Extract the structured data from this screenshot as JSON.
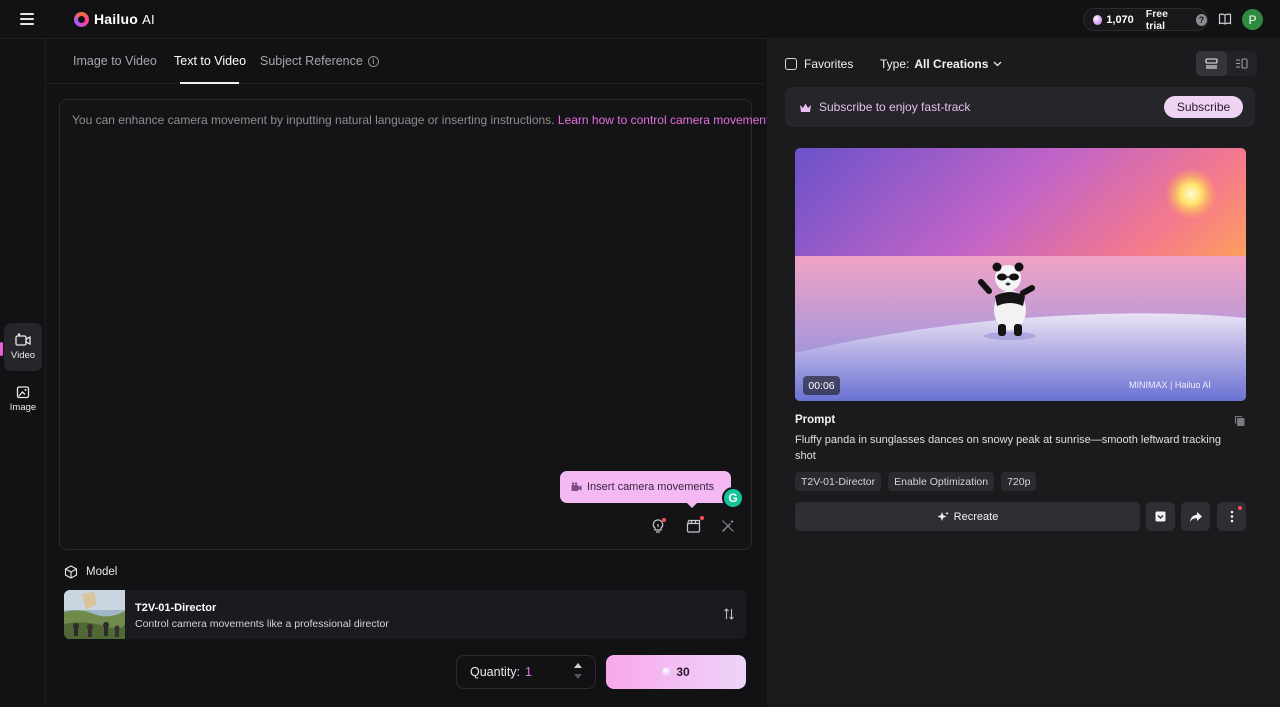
{
  "app": {
    "logo_text": "Hailuo",
    "logo_suffix": "AI"
  },
  "header": {
    "credits": "1,070",
    "free_trial": "Free trial",
    "help_glyph": "?",
    "avatar_letter": "P"
  },
  "leftrail": {
    "items": [
      {
        "label": "Video",
        "icon": "video-icon",
        "active": true
      },
      {
        "label": "Image",
        "icon": "image-icon",
        "active": false
      }
    ]
  },
  "tabs": [
    {
      "label": "Image to Video"
    },
    {
      "label": "Text to Video",
      "active": true
    },
    {
      "label": "Subject Reference",
      "info": "i"
    }
  ],
  "prompt": {
    "placeholder": "You can enhance camera movement by inputting natural language or inserting instructions.",
    "link": "Learn how to control camera movements",
    "tooltip": "Insert camera movements",
    "grammarly": "G"
  },
  "model": {
    "section_label": "Model",
    "name": "T2V-01-Director",
    "description": "Control camera movements like a professional director"
  },
  "quantity": {
    "label": "Quantity:",
    "value": "1"
  },
  "create": {
    "cost": "30"
  },
  "gallery": {
    "favorites_label": "Favorites",
    "type_label": "Type:",
    "type_value": "All Creations",
    "subscribe_text": "Subscribe to enjoy fast-track",
    "subscribe_button": "Subscribe"
  },
  "result": {
    "duration": "00:06",
    "watermark_left": "MINIMAX",
    "watermark_sep": "|",
    "watermark_right": "Hailuo AI",
    "prompt_label": "Prompt",
    "prompt_text": "Fluffy panda in sunglasses dances on snowy peak at sunrise—smooth leftward tracking shot",
    "tags": [
      "T2V-01-Director",
      "Enable Optimization",
      "720p"
    ],
    "recreate_label": "Recreate"
  },
  "colors": {
    "accent": "#e46fe0",
    "create_gradient_start": "#f9a7ec",
    "create_gradient_end": "#ecd4f8",
    "background": "#121214",
    "panel": "#1b1b1e"
  }
}
